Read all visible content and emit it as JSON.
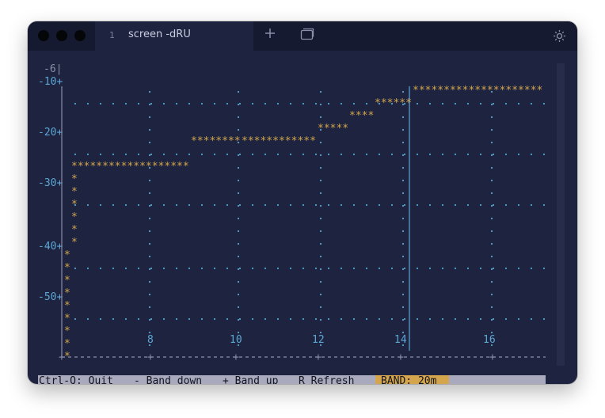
{
  "window": {
    "tab": {
      "index": "1",
      "title": "screen -dRU"
    },
    "toolbar": {
      "new_tab_icon": "plus-icon",
      "window_icon": "windows-icon",
      "settings_icon": "gear-icon"
    }
  },
  "plot": {
    "y_axis": {
      "top_value": "-6|",
      "ticks": [
        {
          "label": "-10+",
          "value": -10
        },
        {
          "label": "-20+",
          "value": -20
        },
        {
          "label": "-30+",
          "value": -30
        },
        {
          "label": "-40+",
          "value": -40
        },
        {
          "label": "-50+",
          "value": -50
        }
      ]
    },
    "x_axis": {
      "ticks": [
        "8",
        "10",
        "12",
        "14",
        "16"
      ]
    },
    "step_runs": [
      "*******************",
      "********",
      "************",
      "*****",
      "****",
      "******",
      "*********************"
    ],
    "marker": "*",
    "colors": {
      "stars": "#d4a54c",
      "ticks": "#5ba7d6",
      "grid": "#5a9fc9",
      "axis": "#8a90a8",
      "background": "#1e2440"
    }
  },
  "status": {
    "quit": "Ctrl-Q: Quit",
    "band_down": "- Band down",
    "band_up": "+ Band up",
    "refresh": "R Refresh",
    "band": "BAND: 20m"
  }
}
